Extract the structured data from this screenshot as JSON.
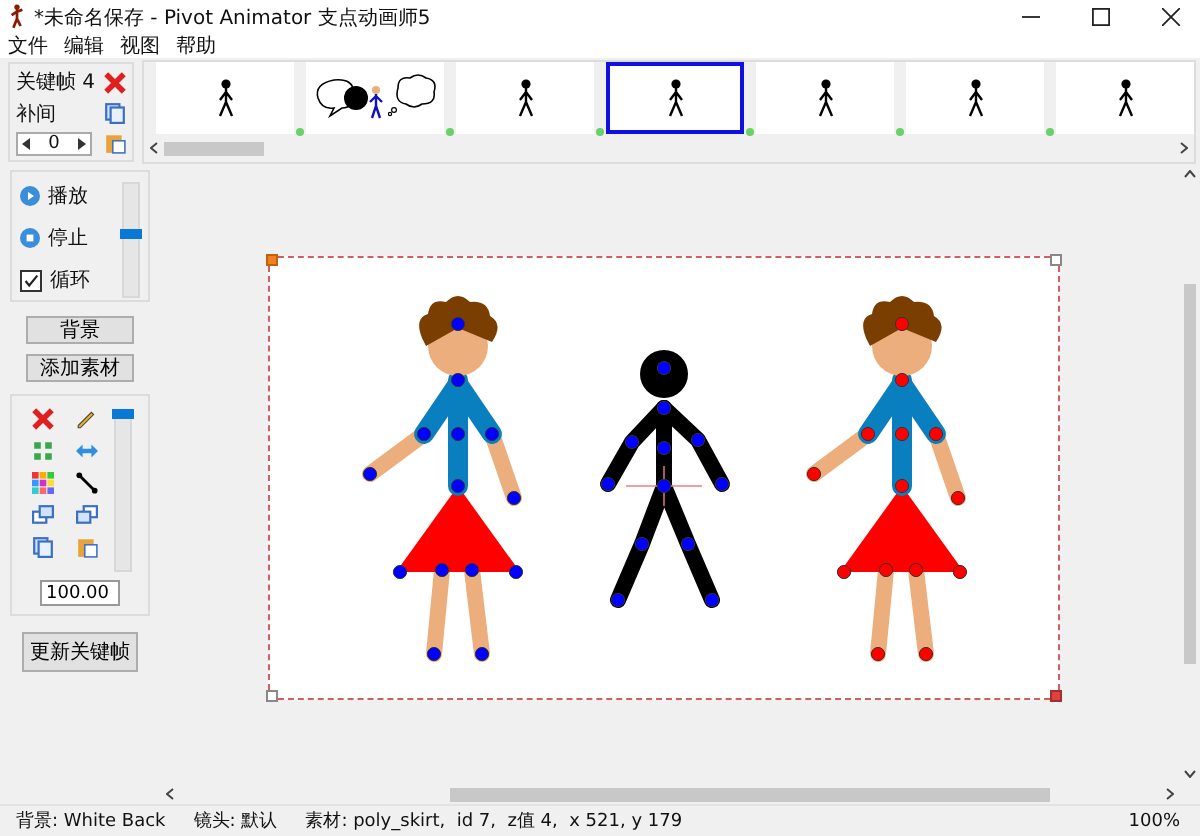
{
  "window": {
    "title": "*未命名保存 - Pivot Animator 支点动画师5"
  },
  "menu": [
    "文件",
    "编辑",
    "视图",
    "帮助"
  ],
  "keyframe_panel": {
    "label": "关键帧 4",
    "tween_label": "补间",
    "tween_value": "0"
  },
  "frames": [
    {
      "kind": "stickman",
      "selected": false
    },
    {
      "kind": "bubbles",
      "selected": false
    },
    {
      "kind": "stickman",
      "selected": false
    },
    {
      "kind": "stickman",
      "selected": true
    },
    {
      "kind": "stickman",
      "selected": false
    },
    {
      "kind": "stickman",
      "selected": false
    },
    {
      "kind": "stickman",
      "selected": false
    }
  ],
  "playback": {
    "play": "播放",
    "stop": "停止",
    "loop": {
      "label": "循环",
      "checked": true
    },
    "speed": {
      "level": 0.55
    }
  },
  "buttons": {
    "background": "背景",
    "add_sprite": "添加素材",
    "update": "更新关键帧"
  },
  "tools": {
    "scale": {
      "level": 1.0
    },
    "scale_value": "100.00"
  },
  "figures": [
    {
      "kind": "girl",
      "color": "#0000ff"
    },
    {
      "kind": "stickman",
      "color": "#0000ff"
    },
    {
      "kind": "girl",
      "color": "#ff0000"
    }
  ],
  "status_bar": [
    "背景: White Back",
    "镜头: 默认",
    "素材: poly_skirt,  id 7,  z值 4,  x 521, y 179",
    "100%"
  ]
}
